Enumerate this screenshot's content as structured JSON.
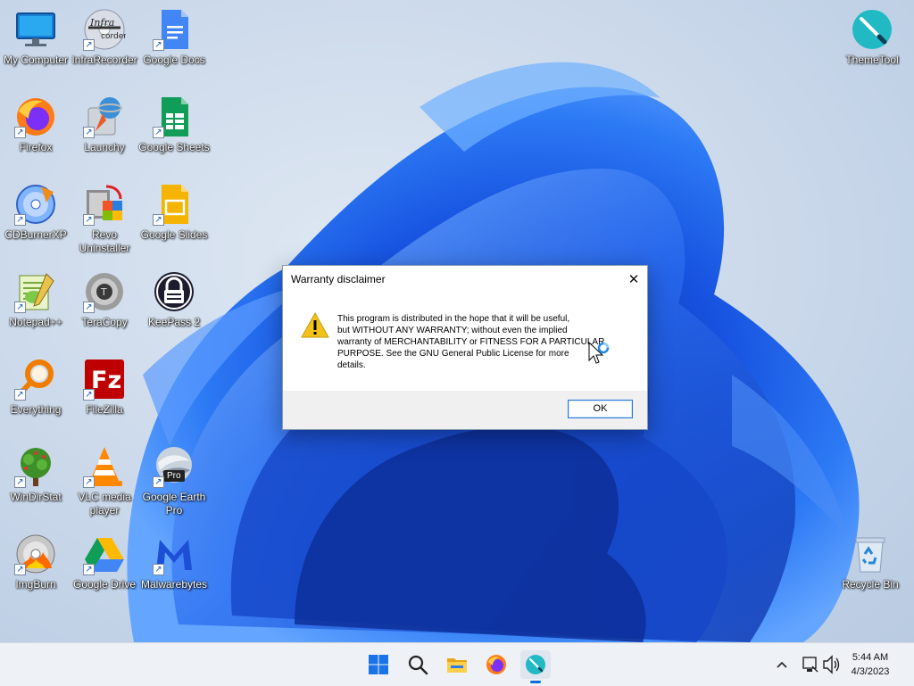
{
  "desktop_icons": [
    {
      "label": "My Computer",
      "icon": "monitor-icon",
      "shortcut": false
    },
    {
      "label": "InfraRecorder",
      "icon": "infrarecorder-disc-icon",
      "shortcut": true
    },
    {
      "label": "Google Docs",
      "icon": "google-docs-icon",
      "shortcut": true
    },
    {
      "label": "Firefox",
      "icon": "firefox-icon",
      "shortcut": true
    },
    {
      "label": "Launchy",
      "icon": "launchy-rocket-icon",
      "shortcut": true
    },
    {
      "label": "Google Sheets",
      "icon": "google-sheets-icon",
      "shortcut": true
    },
    {
      "label": "CDBurnerXP",
      "icon": "cdburnerxp-disc-icon",
      "shortcut": true
    },
    {
      "label": "Revo Uninstaller",
      "icon": "revo-uninstaller-icon",
      "shortcut": true
    },
    {
      "label": "Google Slides",
      "icon": "google-slides-icon",
      "shortcut": true
    },
    {
      "label": "Notepad++",
      "icon": "notepad-plus-plus-icon",
      "shortcut": true
    },
    {
      "label": "TeraCopy",
      "icon": "teracopy-icon",
      "shortcut": true
    },
    {
      "label": "KeePass 2",
      "icon": "keepass-lock-icon",
      "shortcut": false
    },
    {
      "label": "Everything",
      "icon": "everything-search-icon",
      "shortcut": true
    },
    {
      "label": "FileZilla",
      "icon": "filezilla-icon",
      "shortcut": true
    },
    {
      "label": "WinDirStat",
      "icon": "windirstat-tree-icon",
      "shortcut": true
    },
    {
      "label": "VLC media player",
      "icon": "vlc-cone-icon",
      "shortcut": true
    },
    {
      "label": "Google Earth Pro",
      "icon": "google-earth-pro-icon",
      "shortcut": true
    },
    {
      "label": "ImgBurn",
      "icon": "imgburn-disc-icon",
      "shortcut": true
    },
    {
      "label": "Google Drive",
      "icon": "google-drive-icon",
      "shortcut": true
    },
    {
      "label": "Malwarebytes",
      "icon": "malwarebytes-icon",
      "shortcut": true
    },
    {
      "label": "ThemeTool",
      "icon": "themetool-brush-icon",
      "shortcut": false
    },
    {
      "label": "Recycle Bin",
      "icon": "recycle-bin-icon",
      "shortcut": false
    }
  ],
  "earth_badge": "Pro",
  "dialog": {
    "title": "Warranty disclaimer",
    "close_glyph": "✕",
    "message": "This program is distributed in the hope that it will be useful,\nbut WITHOUT ANY WARRANTY; without even the implied\nwarranty of MERCHANTABILITY or FITNESS FOR A PARTICULAR\nPURPOSE.  See the GNU General Public License for more\ndetails.",
    "ok_label": "OK"
  },
  "taskbar": {
    "apps": [
      {
        "name": "start",
        "icon": "windows-start-icon"
      },
      {
        "name": "search",
        "icon": "search-icon"
      },
      {
        "name": "file-explorer",
        "icon": "folder-icon"
      },
      {
        "name": "firefox",
        "icon": "firefox-icon"
      },
      {
        "name": "themetool",
        "icon": "themetool-brush-icon",
        "active": true
      }
    ],
    "tray": [
      "chevron-up-icon",
      "network-icon",
      "volume-icon"
    ],
    "time": "5:44 AM",
    "date": "4/3/2023"
  },
  "colors": {
    "wallpaper_bloom": "#1a5fe0",
    "accent": "#0a6dd9",
    "dialog_button_border": "#2a78d6",
    "warning": "#f2c21b"
  }
}
